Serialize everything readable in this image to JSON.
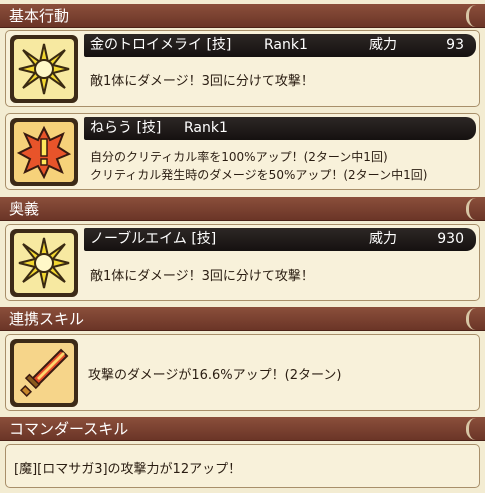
{
  "sections": {
    "basic": "基本行動",
    "ougi": "奥義",
    "renkei": "連携スキル",
    "commander": "コマンダースキル"
  },
  "skills": [
    {
      "name": "金のトロイメライ [技]",
      "rank": "Rank1",
      "power_label": "威力",
      "power": "93",
      "desc": [
        "敵1体にダメージ！3回に分けて攻撃！"
      ],
      "icon": "starburst-icon"
    },
    {
      "name": "ねらう [技]",
      "rank": "Rank1",
      "desc": [
        "自分のクリティカル率を100%アップ！(2ターン中1回)",
        "クリティカル発生時のダメージを50%アップ！(2ターン中1回)"
      ],
      "icon": "exclamation-burst-icon"
    }
  ],
  "ougi": {
    "name": "ノーブルエイム [技]",
    "power_label": "威力",
    "power": "930",
    "desc": [
      "敵1体にダメージ！3回に分けて攻撃！"
    ],
    "icon": "starburst-icon"
  },
  "renkei": {
    "desc": "攻撃のダメージが16.6%アップ！(2ターン)",
    "icon": "flame-sword-icon"
  },
  "commander": {
    "desc": "[魔][ロマサガ3]の攻撃力が12アップ！"
  },
  "colors": {
    "header": "#7a4130",
    "title_bar": "#1f1a18",
    "card_bg": "#f8f1da",
    "icon_bg": "#f7e9a1"
  }
}
